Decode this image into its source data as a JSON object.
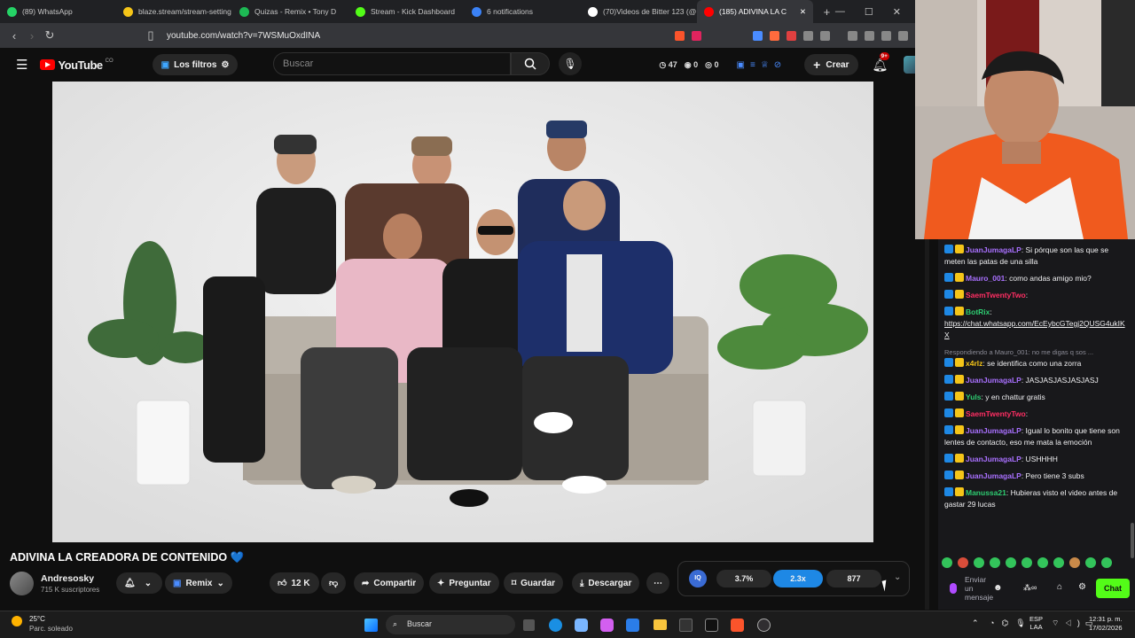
{
  "tabs": [
    {
      "label": "(89) WhatsApp",
      "color": "#25d366"
    },
    {
      "label": "blaze.stream/stream-setting",
      "color": "#f5c518"
    },
    {
      "label": "Quizas - Remix • Tony D",
      "color": "#1db954"
    },
    {
      "label": "Stream - Kick Dashboard",
      "color": "#53fc18"
    },
    {
      "label": "6 notifications",
      "color": "#3b82f6"
    },
    {
      "label": "(70)Videos de Bitter 123 (@",
      "color": "#ffffff"
    },
    {
      "label": "(185) ADIVINA LA C",
      "color": "#ff0000"
    }
  ],
  "url": "youtube.com/watch?v=7WSMuOxdINA",
  "yt": {
    "logo": "YouTube",
    "region": "CO",
    "filters": "Los filtros",
    "search_placeholder": "Buscar",
    "stats": [
      "47",
      "0",
      "0"
    ],
    "create": "Crear",
    "notif_badge": "9+"
  },
  "video": {
    "title": "ADIVINA LA CREADORA DE CONTENIDO 💙",
    "channel": "Andresosky",
    "subs": "715 K suscriptores",
    "remix": "Remix",
    "likes": "12 K",
    "share": "Compartir",
    "ask": "Preguntar",
    "save": "Guardar",
    "download": "Descargar"
  },
  "widget": {
    "a": "3.7%",
    "b": "2.3x",
    "c": "877"
  },
  "chat": [
    {
      "user": "JuanJumagaLP",
      "color": "#a970ff",
      "text": ": Si pórque son las que se meten las patas de una silla"
    },
    {
      "user": "Mauro_001",
      "color": "#a970ff",
      "text": ": como andas amigo mio?"
    },
    {
      "user": "SaemTwentyTwo",
      "color": "#ff2e63",
      "text": ":"
    },
    {
      "user": "BotRix",
      "color": "#2ecc71",
      "text": ":",
      "link": "https://chat.whatsapp.com/EcEybcGTegj2QUSG4ukIKX"
    },
    {
      "reply": "Respondiendo a Mauro_001: no me digas q sos ...",
      "user": "x4rlz",
      "color": "#f5c518",
      "text": ": se identifica como una zorra"
    },
    {
      "user": "JuanJumagaLP",
      "color": "#a970ff",
      "text": ": JASJASJASJASJASJ"
    },
    {
      "user": "Yuls",
      "color": "#2ecc71",
      "text": ": y en chattur gratis"
    },
    {
      "user": "SaemTwentyTwo",
      "color": "#ff2e63",
      "text": ":"
    },
    {
      "user": "JuanJumagaLP",
      "color": "#a970ff",
      "text": ": Igual lo bonito que tiene son lentes de contacto, eso me mata la emoción"
    },
    {
      "user": "JuanJumagaLP",
      "color": "#a970ff",
      "text": ": USHHHH"
    },
    {
      "user": "JuanJumagaLP",
      "color": "#a970ff",
      "text": ": Pero tiene 3 subs"
    },
    {
      "user": "Manussa21",
      "color": "#2ecc71",
      "text": ": Hubieras visto el video antes de gastar 29 lucas"
    }
  ],
  "chat_input": {
    "placeholder": "Enviar un mensaje",
    "button": "Chat"
  },
  "taskbar": {
    "temp": "25°C",
    "weather": "Parc. soleado",
    "search": "Buscar",
    "lang": "ESP",
    "region": "LAA",
    "time": "12:31 p. m.",
    "date": "17/02/2026"
  }
}
